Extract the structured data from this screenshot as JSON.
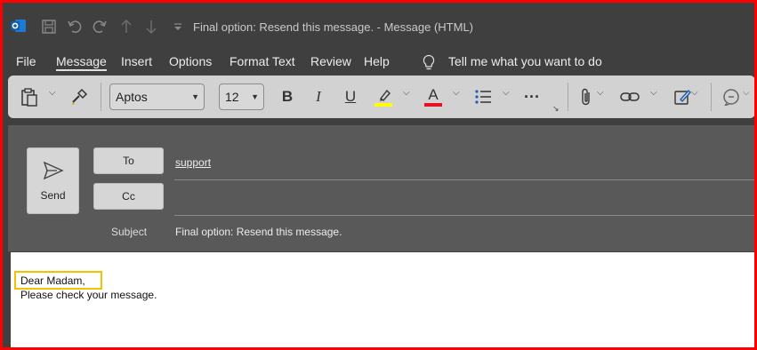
{
  "window": {
    "title": "Final option: Resend this message.  -  Message (HTML)"
  },
  "quick_access": {
    "icons": [
      "outlook-icon",
      "save-icon",
      "undo-icon",
      "redo-icon",
      "up-arrow-icon",
      "down-arrow-icon",
      "customize-icon"
    ]
  },
  "menu": {
    "file": "File",
    "message": "Message",
    "insert": "Insert",
    "options": "Options",
    "format_text": "Format Text",
    "review": "Review",
    "help": "Help",
    "tell_me": "Tell me what you want to do"
  },
  "ribbon": {
    "font_name": "Aptos",
    "font_size": "12",
    "bold": "B",
    "italic": "I",
    "underline": "U",
    "font_color_letter": "A",
    "highlight_color": "#ffff00",
    "font_color": "#e81123",
    "more": "···"
  },
  "header": {
    "send_label": "Send",
    "to_label": "To",
    "cc_label": "Cc",
    "subject_label": "Subject",
    "to_value": "support",
    "cc_value": "",
    "subject_value": "Final option: Resend this message."
  },
  "body": {
    "greeting": "Dear Madam,",
    "line1": "Please check your message."
  },
  "colors": {
    "frame_border": "#ff0000",
    "highlight_box": "#f2c200",
    "titlebar_bg": "#3f3f3f",
    "ribbon_bg": "#d2d2d2",
    "header_bg": "#595959"
  }
}
